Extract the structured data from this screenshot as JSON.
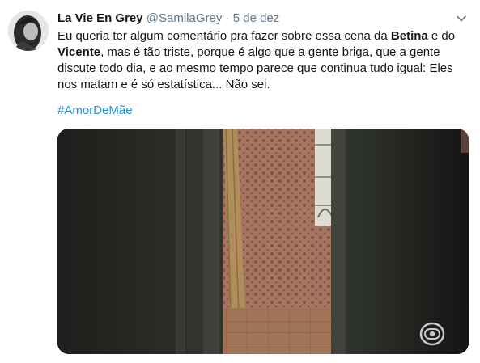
{
  "author": {
    "name": "La Vie En Grey",
    "handle": "@SamilaGrey",
    "separator": "·",
    "timestamp": "5 de dez"
  },
  "tweet": {
    "text_part1": "Eu queria ter algum comentário pra fazer sobre essa cena da ",
    "bold1": "Betina",
    "text_part2": " e do ",
    "bold2": "Vicente",
    "text_part3": ", mas é tão triste, porque é algo que a gente briga, que a gente discute todo dia, e ao mesmo tempo parece que continua tudo igual: Eles nos matam e é só estatística... Não sei.",
    "hashtag": "#AmorDeMãe"
  },
  "icons": {
    "menu": "chevron-down-icon",
    "watermark": "globo-logo-icon"
  },
  "colors": {
    "text": "#14171a",
    "secondary": "#657786",
    "link": "#1b95e0"
  }
}
